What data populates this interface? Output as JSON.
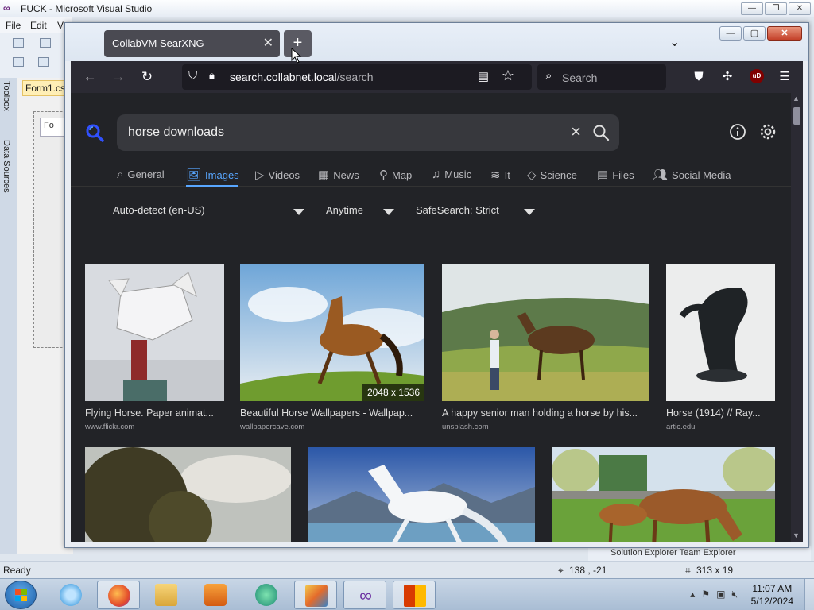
{
  "vs": {
    "title": "FUCK - Microsoft Visual Studio",
    "menu": [
      "File",
      "Edit",
      "V"
    ],
    "doc_tab": "Form1.cs",
    "form_title": "Fo",
    "left_tabs": [
      "Toolbox",
      "Data Sources"
    ],
    "status_ready": "Ready",
    "status_pos": "138 , -21",
    "status_size": "313 x 19",
    "solution_tabs": "Solution Explorer   Team Explorer"
  },
  "browser": {
    "tab_title": "CollabVM SearXNG",
    "url_host": "search.collabnet.local",
    "url_path": "/search",
    "search_placeholder": "Search",
    "ublock_label": "uD"
  },
  "searx": {
    "query": "horse downloads",
    "categories": [
      {
        "label": "General",
        "icon": "search-icon"
      },
      {
        "label": "Images",
        "icon": "image-icon",
        "active": true
      },
      {
        "label": "Videos",
        "icon": "play-icon"
      },
      {
        "label": "News",
        "icon": "newspaper-icon"
      },
      {
        "label": "Map",
        "icon": "map-pin-icon"
      },
      {
        "label": "Music",
        "icon": "music-icon"
      },
      {
        "label": "It",
        "icon": "layers-icon"
      },
      {
        "label": "Science",
        "icon": "graduation-cap-icon"
      },
      {
        "label": "Files",
        "icon": "files-icon"
      },
      {
        "label": "Social Media",
        "icon": "people-icon"
      }
    ],
    "filters": {
      "language": "Auto-detect (en-US)",
      "time": "Anytime",
      "safesearch": "SafeSearch: Strict"
    },
    "results": [
      {
        "title": "Flying Horse. Paper animat...",
        "source": "www.flickr.com"
      },
      {
        "title": "Beautiful Horse Wallpapers - Wallpap...",
        "source": "wallpapercave.com",
        "dims": "2048 x 1536"
      },
      {
        "title": "A happy senior man holding a horse by his...",
        "source": "unsplash.com"
      },
      {
        "title": "Horse (1914) // Ray...",
        "source": "artic.edu"
      }
    ]
  },
  "taskbar": {
    "time": "11:07 AM",
    "date": "5/12/2024"
  },
  "colors": {
    "accent": "#58a6ff",
    "page_bg": "#222327",
    "toolbar_bg": "#2b2a33"
  }
}
